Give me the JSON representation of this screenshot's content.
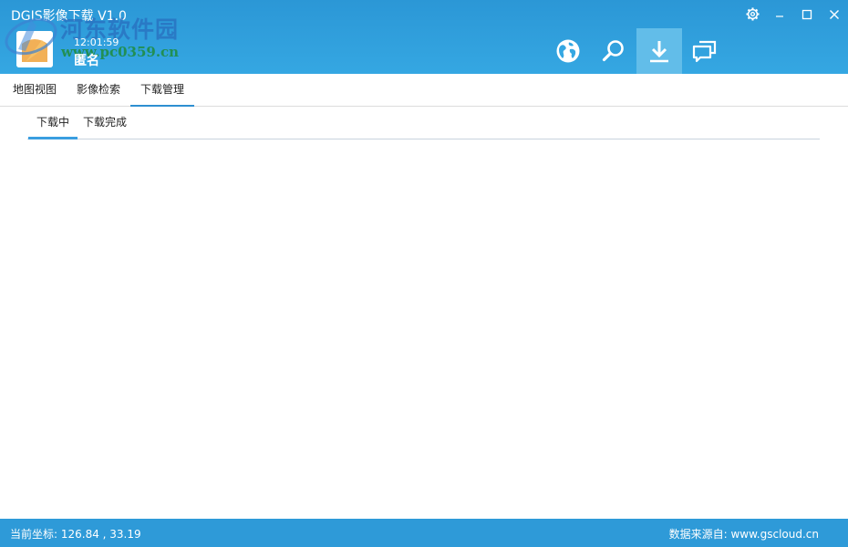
{
  "window": {
    "title": "DGIS影像下载 V1.0"
  },
  "user": {
    "time": "12:01:59",
    "name": "匿名"
  },
  "watermark": {
    "title": "河东软件园",
    "url": "www.pc0359.cn"
  },
  "toolbar": {
    "items": [
      {
        "icon": "globe-icon",
        "active": false
      },
      {
        "icon": "search-icon",
        "active": false
      },
      {
        "icon": "download-icon",
        "active": true
      },
      {
        "icon": "chat-icon",
        "active": false
      }
    ]
  },
  "main_tabs": [
    {
      "label": "地图视图",
      "active": false
    },
    {
      "label": "影像检索",
      "active": false
    },
    {
      "label": "下载管理",
      "active": true
    }
  ],
  "sub_tabs": [
    {
      "label": "下载中",
      "active": true
    },
    {
      "label": "下载完成",
      "active": false
    }
  ],
  "status": {
    "coords": "当前坐标: 126.84 , 33.19",
    "source": "数据来源自: www.gscloud.cn"
  },
  "colors": {
    "header": "#35a7e2",
    "active_tool": "#62bde9",
    "tab_underline": "#2e8fd1",
    "statusbar": "#2e9ad8"
  }
}
